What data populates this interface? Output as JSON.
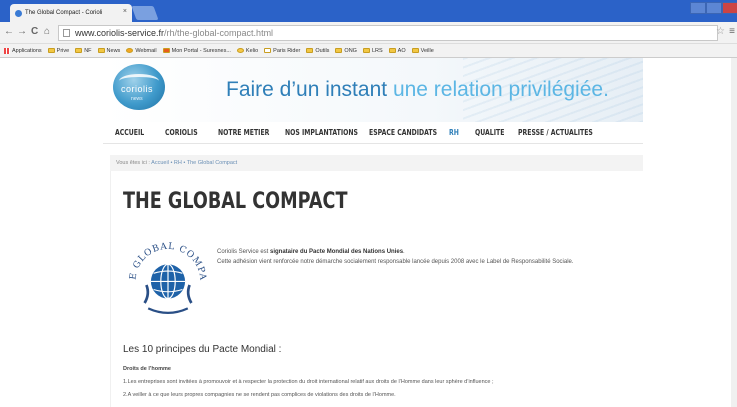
{
  "browser": {
    "tab_title": "The Global Compact - Corioli",
    "tab_close": "×",
    "url_domain": "www.coriolis-service.fr",
    "url_path": "/rh/the-global-compact.html",
    "nav_back": "←",
    "nav_forward": "→",
    "nav_reload": "C",
    "nav_home": "⌂",
    "star": "☆",
    "menu": "≡",
    "bookmarks": [
      "Applications",
      "Prive",
      "NF",
      "News",
      "Webmail",
      "Mon Portal - Suresnes...",
      "Kelio",
      "Paris Rider",
      "Outils",
      "ONG",
      "LRS",
      "AO",
      "Veille"
    ]
  },
  "site": {
    "logo_name": "coriolis",
    "logo_sub": "news",
    "slogan_a": "Faire d’un instant",
    "slogan_b": "une relation privilégiée.",
    "nav": [
      "ACCUEIL",
      "CORIOLIS",
      "NOTRE METIER",
      "NOS IMPLANTATIONS",
      "ESPACE CANDIDATS",
      "RH",
      "QUALITE",
      "PRESSE / ACTUALITES"
    ],
    "active_nav": "RH",
    "breadcrumb_label": "Vous êtes ici :",
    "breadcrumb": [
      "Accueil",
      "RH",
      "The Global Compact"
    ],
    "breadcrumb_sep": "•"
  },
  "content": {
    "title": "THE GLOBAL COMPACT",
    "logo_text": "THE GLOBAL COMPACT",
    "intro_lead": "Coriolis Service est ",
    "intro_bold": "signataire du Pacte Mondial des Nations Unies",
    "intro_end": ".",
    "intro_line2": "Cette adhésion vient renforcée notre démarche socialement responsable lancée depuis 2008 avec le Label de Responsabilité Sociale.",
    "section_title": "Les 10 principes du Pacte Mondial :",
    "subsection": "Droits de l’homme",
    "principle_1": "1.Les entreprises sont invitées à promouvoir et à respecter la protection du droit international relatif aux droits de l’Homme dans leur sphère d’influence ;",
    "principle_2": "2.A veiller à ce que leurs propres compagnies ne se rendent pas complices de violations des droits de l’Homme."
  }
}
